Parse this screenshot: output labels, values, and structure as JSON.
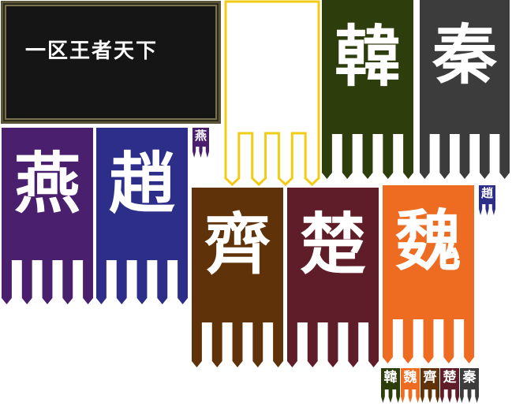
{
  "title_plaque": {
    "text": "一区王者天下"
  },
  "banners": [
    {
      "id": "blank",
      "char": "",
      "color": "#ffffff"
    },
    {
      "id": "han",
      "char": "韓",
      "color": "#2d3d0b"
    },
    {
      "id": "qin",
      "char": "秦",
      "color": "#3c3c3c"
    },
    {
      "id": "yan",
      "char": "燕",
      "color": "#4a1f6e"
    },
    {
      "id": "zhao",
      "char": "趙",
      "color": "#2d2d8a"
    },
    {
      "id": "qi",
      "char": "齊",
      "color": "#5f3209"
    },
    {
      "id": "chu",
      "char": "楚",
      "color": "#5e1d28"
    },
    {
      "id": "wei",
      "char": "魏",
      "color": "#ee6b22"
    }
  ],
  "mini_banners": [
    {
      "id": "yan-mini",
      "char": "燕"
    },
    {
      "id": "zhao-mini",
      "char": "趙"
    },
    {
      "id": "han-mini",
      "char": "韓"
    },
    {
      "id": "wei-mini",
      "char": "魏"
    },
    {
      "id": "qi-mini",
      "char": "齊"
    },
    {
      "id": "chu-mini",
      "char": "楚"
    },
    {
      "id": "qin-mini",
      "char": "秦"
    }
  ],
  "colors": {
    "blank_outline": "#f2cc14",
    "plaque_bg": "#151515",
    "plaque_border": "#77704a"
  }
}
